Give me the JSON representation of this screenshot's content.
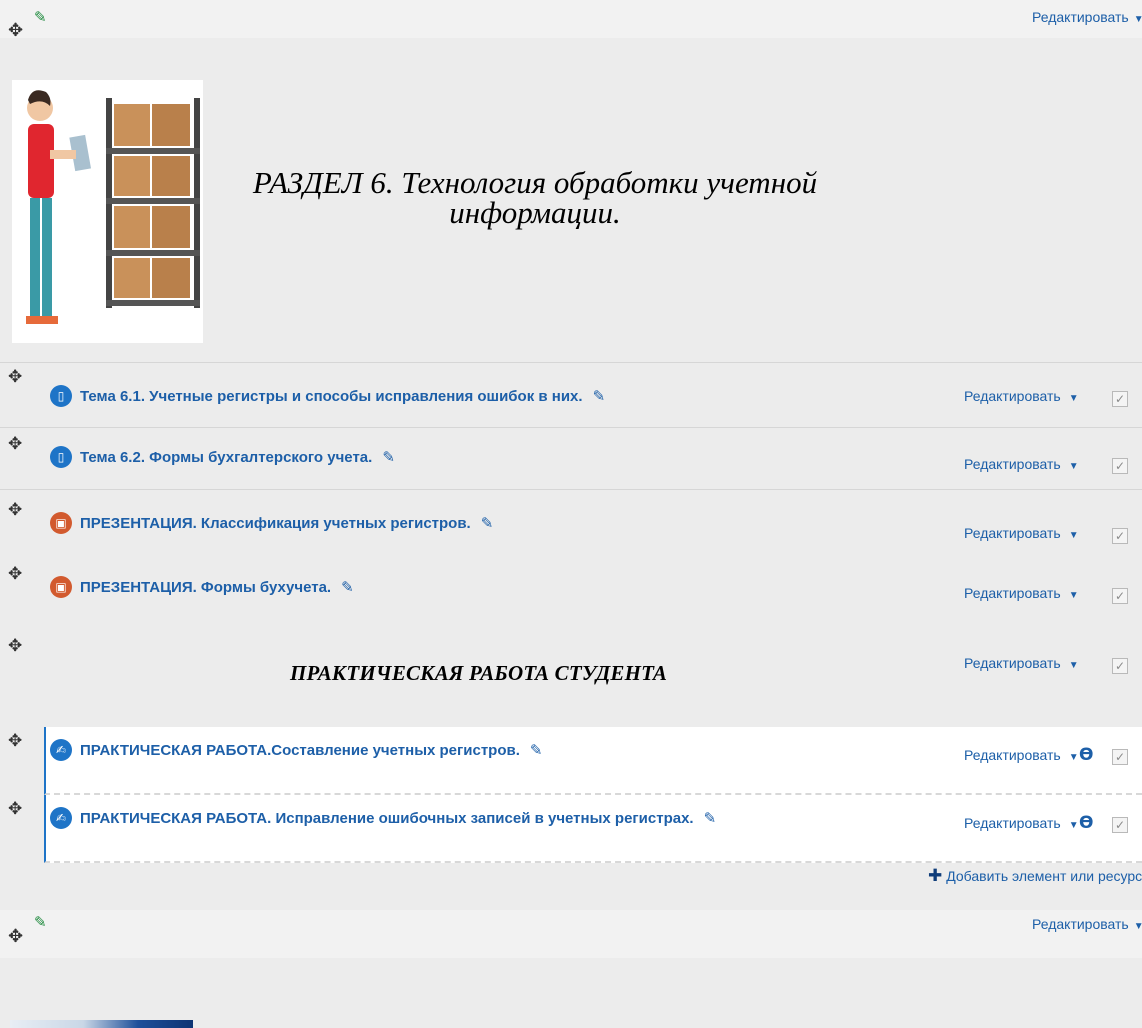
{
  "section6": {
    "edit_label": "Редактировать",
    "banner_title_line1": "РАЗДЕЛ 6. Технология обработки учетной",
    "banner_title_line2": "информации.",
    "activities": [
      {
        "icon": "file-icon",
        "title": "Тема 6.1. Учетные регистры и способы исправления ошибок в них.",
        "edit": "Редактировать"
      },
      {
        "icon": "file-icon",
        "title": "Тема 6.2. Формы бухгалтерского учета.",
        "edit": "Редактировать"
      },
      {
        "icon": "presentation-icon",
        "title": "ПРЕЗЕНТАЦИЯ. Классификация учетных регистров.",
        "edit": "Редактировать"
      },
      {
        "icon": "presentation-icon",
        "title": "ПРЕЗЕНТАЦИЯ. Формы бухучета.",
        "edit": "Редактировать"
      }
    ],
    "label_block": {
      "text": "ПРАКТИЧЕСКАЯ РАБОТА СТУДЕНТА",
      "edit": "Редактировать"
    },
    "assignments": [
      {
        "icon": "assignment-icon",
        "title": "ПРАКТИЧЕСКАЯ РАБОТА.Составление учетных регистров.",
        "edit": "Редактировать"
      },
      {
        "icon": "assignment-icon",
        "title": "ПРАКТИЧЕСКАЯ РАБОТА. Исправление ошибочных записей в учетных регистрах.",
        "edit": "Редактировать"
      }
    ],
    "add_resource": "Добавить элемент или ресурс"
  },
  "section7": {
    "edit_label": "Редактировать"
  },
  "colors": {
    "link": "#1d5fa8",
    "accent_green": "#1e8a3d",
    "file_icon": "#1e74c7",
    "presentation_icon": "#d25a2e"
  }
}
